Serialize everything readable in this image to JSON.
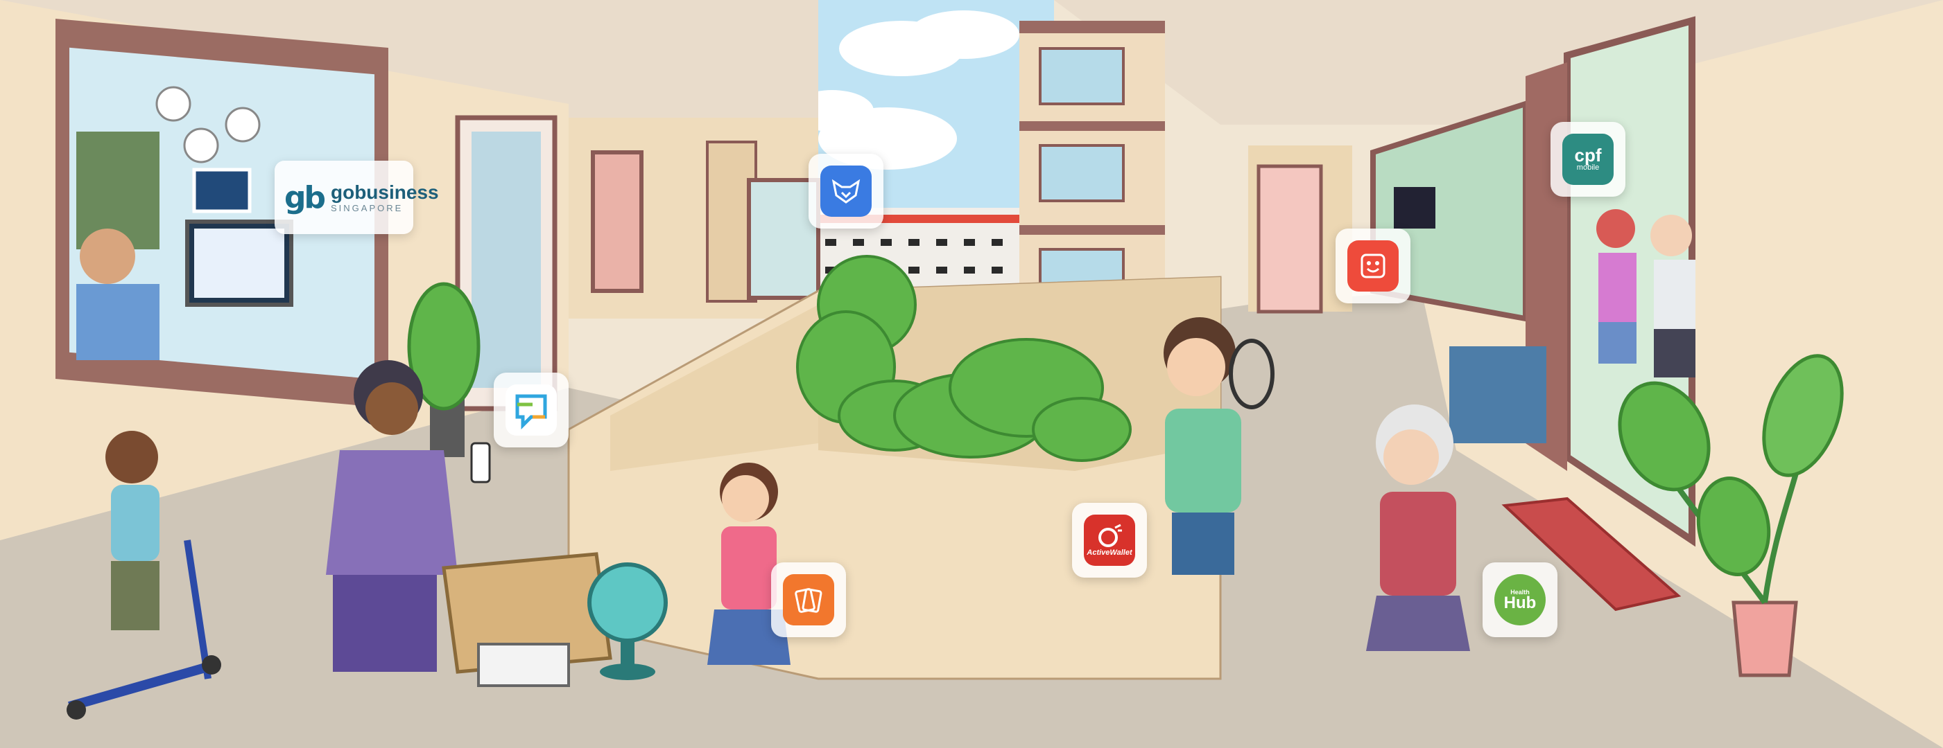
{
  "scene": {
    "palette": {
      "wall": "#f3e2c6",
      "floor": "#cfc6b8",
      "ceiling": "#e9dccb",
      "frame": "#8a5a55",
      "sky": "#bfe3f4",
      "greenery": "#5fb54a"
    }
  },
  "logos": {
    "gobusiness": {
      "mark": "gb",
      "name": "gobusiness",
      "sub": "SINGAPORE",
      "color": "#1d5f7a"
    },
    "activewallet": {
      "label": "ActiveWallet",
      "color": "#d8322b"
    },
    "cpf": {
      "main": "cpf",
      "sub": "mobile",
      "color": "#2d8c82"
    },
    "healthhub": {
      "small": "Health",
      "big": "Hub",
      "color": "#6ab344"
    }
  },
  "app_icons": [
    {
      "name": "fox-app-icon",
      "color": "#3a7be2"
    },
    {
      "name": "smiley-app-icon",
      "color": "#ee4b3b"
    },
    {
      "name": "chat-app-icon",
      "color": "#2fa6df"
    },
    {
      "name": "cards-app-icon",
      "color": "#f2772d"
    }
  ]
}
